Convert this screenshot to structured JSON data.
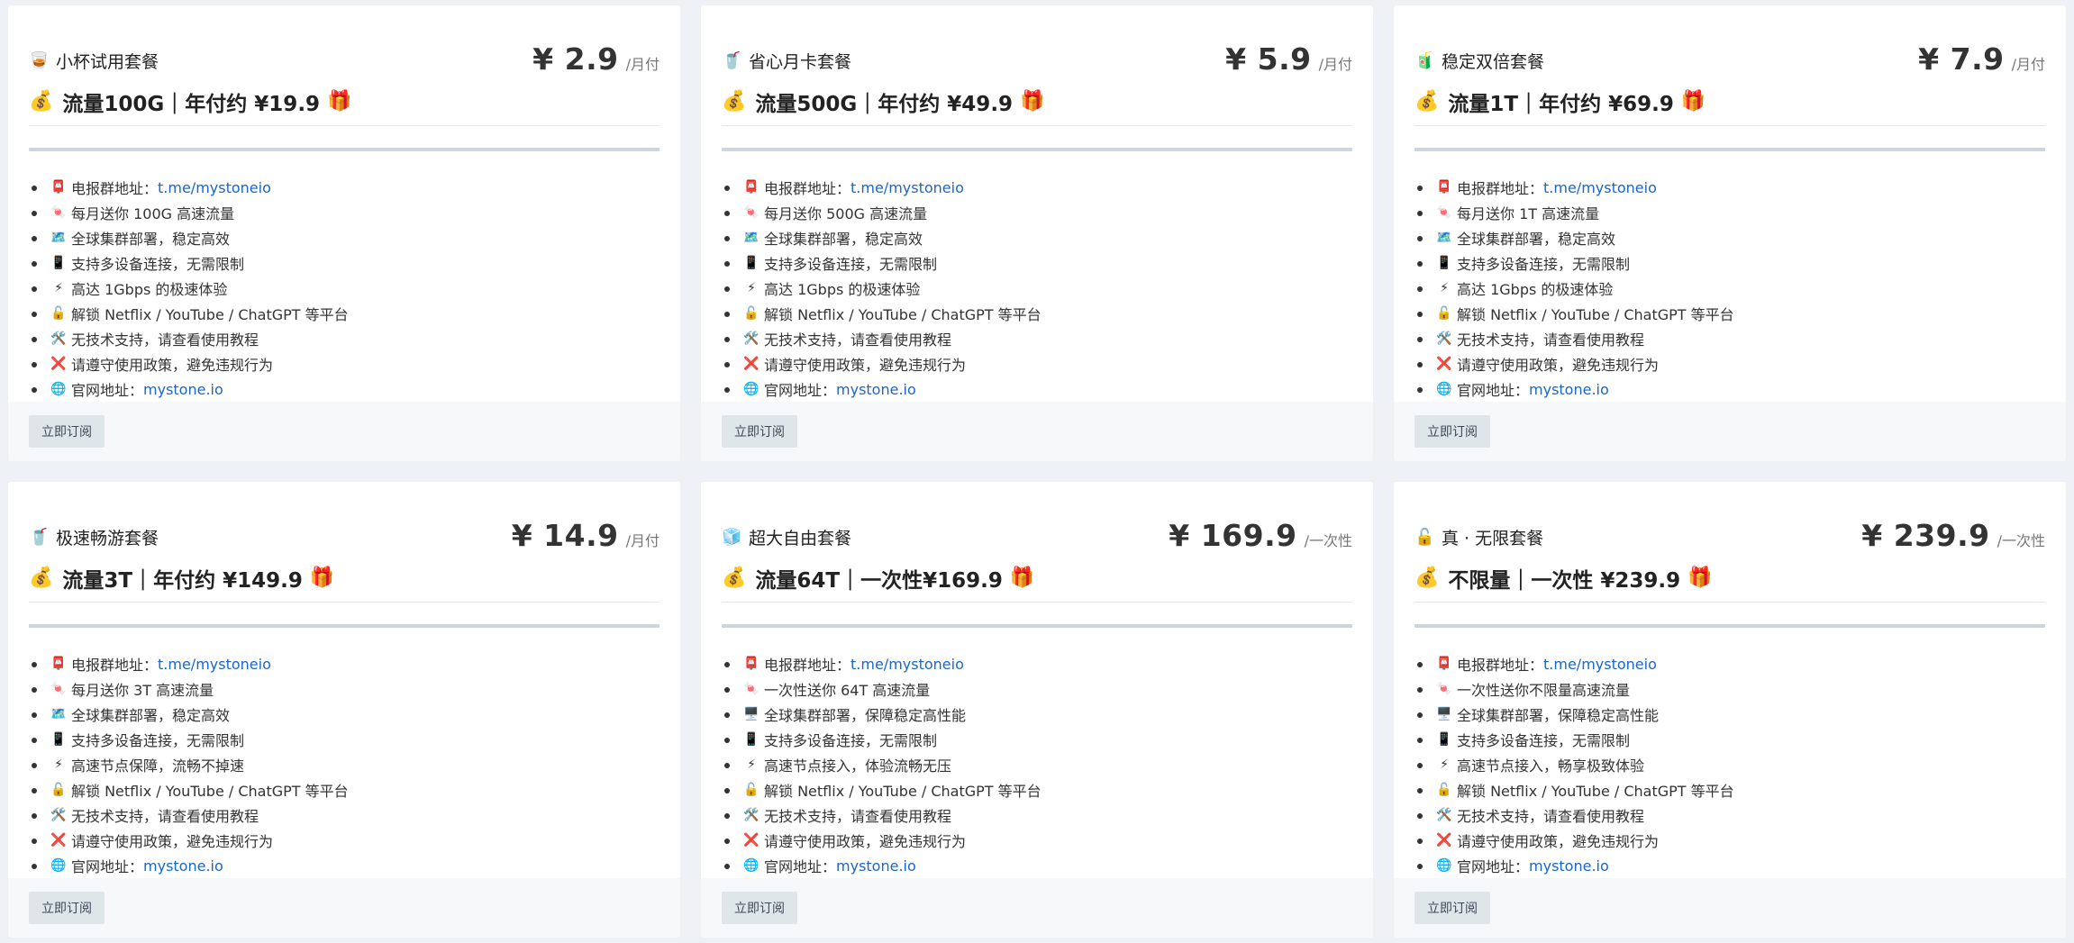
{
  "plans": [
    {
      "icon": "coffee-cup-icon",
      "icon_glyph": "🥃",
      "title": "小杯试用套餐",
      "price": "¥ 2.9",
      "period": "/月付",
      "headline": "流量100G｜年付约 ¥19.9",
      "features": [
        {
          "icon": "pin-icon",
          "glyph": "📮",
          "label": "电报群地址：",
          "link": "t.me/mystoneio"
        },
        {
          "icon": "candy-icon",
          "glyph": "🍬",
          "label": "每月送你 100G 高速流量"
        },
        {
          "icon": "map-icon",
          "glyph": "🗺️",
          "label": "全球集群部署，稳定高效"
        },
        {
          "icon": "phone-icon",
          "glyph": "📱",
          "label": "支持多设备连接，无需限制"
        },
        {
          "icon": "bolt-icon",
          "glyph": "⚡",
          "label": "高达 1Gbps 的极速体验"
        },
        {
          "icon": "unlock-icon",
          "glyph": "🔓",
          "label": "解锁 Netflix / YouTube / ChatGPT 等平台"
        },
        {
          "icon": "tools-icon",
          "glyph": "🛠️",
          "label": "无技术支持，请查看使用教程"
        },
        {
          "icon": "cross-icon",
          "glyph": "❌",
          "label": "请遵守使用政策，避免违规行为"
        },
        {
          "icon": "globe-icon",
          "glyph": "🌐",
          "label": "官网地址：",
          "link": "mystone.io"
        }
      ],
      "button": "立即订阅"
    },
    {
      "icon": "cup-icon",
      "icon_glyph": "🥤",
      "title": "省心月卡套餐",
      "price": "¥ 5.9",
      "period": "/月付",
      "headline": "流量500G｜年付约 ¥49.9",
      "features": [
        {
          "icon": "pin-icon",
          "glyph": "📮",
          "label": "电报群地址：",
          "link": "t.me/mystoneio"
        },
        {
          "icon": "candy-icon",
          "glyph": "🍬",
          "label": "每月送你 500G 高速流量"
        },
        {
          "icon": "map-icon",
          "glyph": "🗺️",
          "label": "全球集群部署，稳定高效"
        },
        {
          "icon": "phone-icon",
          "glyph": "📱",
          "label": "支持多设备连接，无需限制"
        },
        {
          "icon": "bolt-icon",
          "glyph": "⚡",
          "label": "高达 1Gbps 的极速体验"
        },
        {
          "icon": "unlock-icon",
          "glyph": "🔓",
          "label": "解锁 Netflix / YouTube / ChatGPT 等平台"
        },
        {
          "icon": "tools-icon",
          "glyph": "🛠️",
          "label": "无技术支持，请查看使用教程"
        },
        {
          "icon": "cross-icon",
          "glyph": "❌",
          "label": "请遵守使用政策，避免违规行为"
        },
        {
          "icon": "globe-icon",
          "glyph": "🌐",
          "label": "官网地址：",
          "link": "mystone.io"
        }
      ],
      "button": "立即订阅"
    },
    {
      "icon": "juice-box-icon",
      "icon_glyph": "🧃",
      "title": "稳定双倍套餐",
      "price": "¥ 7.9",
      "period": "/月付",
      "headline": "流量1T｜年付约 ¥69.9",
      "features": [
        {
          "icon": "pin-icon",
          "glyph": "📮",
          "label": "电报群地址：",
          "link": "t.me/mystoneio"
        },
        {
          "icon": "candy-icon",
          "glyph": "🍬",
          "label": "每月送你 1T 高速流量"
        },
        {
          "icon": "map-icon",
          "glyph": "🗺️",
          "label": "全球集群部署，稳定高效"
        },
        {
          "icon": "phone-icon",
          "glyph": "📱",
          "label": "支持多设备连接，无需限制"
        },
        {
          "icon": "bolt-icon",
          "glyph": "⚡",
          "label": "高达 1Gbps 的极速体验"
        },
        {
          "icon": "unlock-icon",
          "glyph": "🔓",
          "label": "解锁 Netflix / YouTube / ChatGPT 等平台"
        },
        {
          "icon": "tools-icon",
          "glyph": "🛠️",
          "label": "无技术支持，请查看使用教程"
        },
        {
          "icon": "cross-icon",
          "glyph": "❌",
          "label": "请遵守使用政策，避免违规行为"
        },
        {
          "icon": "globe-icon",
          "glyph": "🌐",
          "label": "官网地址：",
          "link": "mystone.io"
        }
      ],
      "button": "立即订阅"
    },
    {
      "icon": "cup-icon",
      "icon_glyph": "🥤",
      "title": "极速畅游套餐",
      "price": "¥ 14.9",
      "period": "/月付",
      "headline": "流量3T｜年付约 ¥149.9",
      "features": [
        {
          "icon": "pin-icon",
          "glyph": "📮",
          "label": "电报群地址：",
          "link": "t.me/mystoneio"
        },
        {
          "icon": "candy-icon",
          "glyph": "🍬",
          "label": "每月送你 3T 高速流量"
        },
        {
          "icon": "map-icon",
          "glyph": "🗺️",
          "label": "全球集群部署，稳定高效"
        },
        {
          "icon": "phone-icon",
          "glyph": "📱",
          "label": "支持多设备连接，无需限制"
        },
        {
          "icon": "bolt-icon",
          "glyph": "⚡",
          "label": "高速节点保障，流畅不掉速"
        },
        {
          "icon": "unlock-icon",
          "glyph": "🔓",
          "label": "解锁 Netflix / YouTube / ChatGPT 等平台"
        },
        {
          "icon": "tools-icon",
          "glyph": "🛠️",
          "label": "无技术支持，请查看使用教程"
        },
        {
          "icon": "cross-icon",
          "glyph": "❌",
          "label": "请遵守使用政策，避免违规行为"
        },
        {
          "icon": "globe-icon",
          "glyph": "🌐",
          "label": "官网地址：",
          "link": "mystone.io"
        }
      ],
      "button": "立即订阅"
    },
    {
      "icon": "ice-cube-icon",
      "icon_glyph": "🧊",
      "title": "超大自由套餐",
      "price": "¥ 169.9",
      "period": "/一次性",
      "headline": "流量64T｜一次性¥169.9",
      "features": [
        {
          "icon": "pin-icon",
          "glyph": "📮",
          "label": "电报群地址：",
          "link": "t.me/mystoneio"
        },
        {
          "icon": "candy-icon",
          "glyph": "🍬",
          "label": "一次性送你 64T 高速流量"
        },
        {
          "icon": "monitor-icon",
          "glyph": "🖥️",
          "label": "全球集群部署，保障稳定高性能"
        },
        {
          "icon": "phone-icon",
          "glyph": "📱",
          "label": "支持多设备连接，无需限制"
        },
        {
          "icon": "bolt-icon",
          "glyph": "⚡",
          "label": "高速节点接入，体验流畅无压"
        },
        {
          "icon": "unlock-icon",
          "glyph": "🔓",
          "label": "解锁 Netflix / YouTube / ChatGPT 等平台"
        },
        {
          "icon": "tools-icon",
          "glyph": "🛠️",
          "label": "无技术支持，请查看使用教程"
        },
        {
          "icon": "cross-icon",
          "glyph": "❌",
          "label": "请遵守使用政策，避免违规行为"
        },
        {
          "icon": "globe-icon",
          "glyph": "🌐",
          "label": "官网地址：",
          "link": "mystone.io"
        }
      ],
      "button": "立即订阅"
    },
    {
      "icon": "unlock-icon",
      "icon_glyph": "🔓",
      "title": "真 · 无限套餐",
      "price": "¥ 239.9",
      "period": "/一次性",
      "headline": "不限量｜一次性 ¥239.9",
      "features": [
        {
          "icon": "pin-icon",
          "glyph": "📮",
          "label": "电报群地址：",
          "link": "t.me/mystoneio"
        },
        {
          "icon": "candy-icon",
          "glyph": "🍬",
          "label": "一次性送你不限量高速流量"
        },
        {
          "icon": "monitor-icon",
          "glyph": "🖥️",
          "label": "全球集群部署，保障稳定高性能"
        },
        {
          "icon": "phone-icon",
          "glyph": "📱",
          "label": "支持多设备连接，无需限制"
        },
        {
          "icon": "bolt-icon",
          "glyph": "⚡",
          "label": "高速节点接入，畅享极致体验"
        },
        {
          "icon": "unlock-icon",
          "glyph": "🔓",
          "label": "解锁 Netflix / YouTube / ChatGPT 等平台"
        },
        {
          "icon": "tools-icon",
          "glyph": "🛠️",
          "label": "无技术支持，请查看使用教程"
        },
        {
          "icon": "cross-icon",
          "glyph": "❌",
          "label": "请遵守使用政策，避免违规行为"
        },
        {
          "icon": "globe-icon",
          "glyph": "🌐",
          "label": "官网地址：",
          "link": "mystone.io"
        }
      ],
      "button": "立即订阅"
    }
  ],
  "headline_icons": {
    "money": "💰",
    "gift": "🎁"
  },
  "colors": {
    "link": "#1a66c9",
    "rule": "#cfd5dd",
    "button_bg": "#dfe6ea",
    "footer_bg": "#f7f8fa",
    "page_bg": "#eef1f5"
  }
}
